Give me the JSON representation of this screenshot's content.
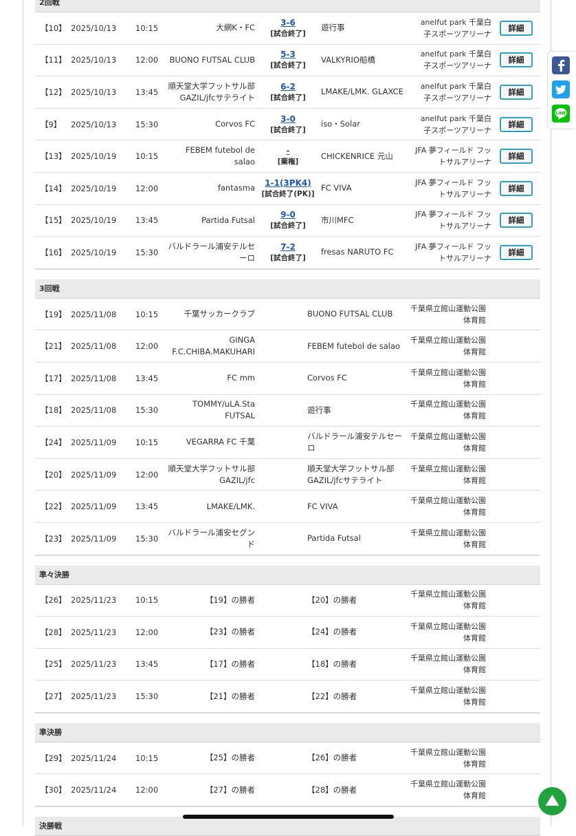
{
  "detail_label": "詳細",
  "sections": [
    {
      "title": "2回戦",
      "matches": [
        {
          "no": "【10】",
          "date": "2025/10/13",
          "time": "10:15",
          "home": "大網K・FC",
          "score": "3-6",
          "status": "[試合終了]",
          "away": "遊行事",
          "venue": "anelfut park 千葉白子スポーツアリーナ"
        },
        {
          "no": "【11】",
          "date": "2025/10/13",
          "time": "12:00",
          "home": "BUONO FUTSAL CLUB",
          "score": "5-3",
          "status": "[試合終了]",
          "away": "VALKYRIO船橋",
          "venue": "anelfut park 千葉白子スポーツアリーナ"
        },
        {
          "no": "【12】",
          "date": "2025/10/13",
          "time": "13:45",
          "home": "順天堂大学フットサル部GAZIL/jfcサテライト",
          "score": "6-2",
          "status": "[試合終了]",
          "away": "LMAKE/LMK. GLAXCE",
          "venue": "anelfut park 千葉白子スポーツアリーナ"
        },
        {
          "no": "【9】",
          "date": "2025/10/13",
          "time": "15:30",
          "home": "Corvos FC",
          "score": "3-0",
          "status": "[試合終了]",
          "away": "iso・Solar",
          "venue": "anelfut park 千葉白子スポーツアリーナ"
        },
        {
          "no": "【13】",
          "date": "2025/10/19",
          "time": "10:15",
          "home": "FEBEM futebol de salao",
          "score": "-",
          "status": "[棄権]",
          "away": "CHICKENRICE 元山",
          "venue": "JFA 夢フィールド フットサルアリーナ"
        },
        {
          "no": "【14】",
          "date": "2025/10/19",
          "time": "12:00",
          "home": "fantasma",
          "score": "1-1(3PK4)",
          "status": "[試合終了(PK)]",
          "away": "FC VIVA",
          "venue": "JFA 夢フィールド フットサルアリーナ"
        },
        {
          "no": "【15】",
          "date": "2025/10/19",
          "time": "13:45",
          "home": "Partida Futsal",
          "score": "9-0",
          "status": "[試合終了]",
          "away": "市川MFC",
          "venue": "JFA 夢フィールド フットサルアリーナ"
        },
        {
          "no": "【16】",
          "date": "2025/10/19",
          "time": "15:30",
          "home": "バルドラール浦安テルセーロ",
          "score": "7-2",
          "status": "[試合終了]",
          "away": "fresas NARUTO FC",
          "venue": "JFA 夢フィールド フットサルアリーナ"
        }
      ]
    },
    {
      "title": "3回戦",
      "matches": [
        {
          "no": "【19】",
          "date": "2025/11/08",
          "time": "10:15",
          "home": "千葉サッカークラブ",
          "away": "BUONO FUTSAL CLUB",
          "venue": "千葉県立館山運動公園体育館"
        },
        {
          "no": "【21】",
          "date": "2025/11/08",
          "time": "12:00",
          "home": "GINGA F.C.CHIBA.MAKUHARI",
          "away": "FEBEM futebol de salao",
          "venue": "千葉県立館山運動公園体育館"
        },
        {
          "no": "【17】",
          "date": "2025/11/08",
          "time": "13:45",
          "home": "FC mm",
          "away": "Corvos FC",
          "venue": "千葉県立館山運動公園体育館"
        },
        {
          "no": "【18】",
          "date": "2025/11/08",
          "time": "15:30",
          "home": "TOMMY/uLA.Sta FUTSAL",
          "away": "遊行事",
          "venue": "千葉県立館山運動公園体育館"
        },
        {
          "no": "【24】",
          "date": "2025/11/09",
          "time": "10:15",
          "home": "VEGARRA FC 千葉",
          "away": "バルドラール浦安テルセーロ",
          "venue": "千葉県立館山運動公園体育館"
        },
        {
          "no": "【20】",
          "date": "2025/11/09",
          "time": "12:00",
          "home": "順天堂大学フットサル部GAZIL/jfc",
          "away": "順天堂大学フットサル部GAZIL/jfcサテライト",
          "venue": "千葉県立館山運動公園体育館"
        },
        {
          "no": "【22】",
          "date": "2025/11/09",
          "time": "13:45",
          "home": "LMAKE/LMK.",
          "away": "FC VIVA",
          "venue": "千葉県立館山運動公園体育館"
        },
        {
          "no": "【23】",
          "date": "2025/11/09",
          "time": "15:30",
          "home": "バルドラール浦安セグンド",
          "away": "Partida Futsal",
          "venue": "千葉県立館山運動公園体育館"
        }
      ]
    },
    {
      "title": "準々決勝",
      "matches": [
        {
          "no": "【26】",
          "date": "2025/11/23",
          "time": "10:15",
          "home": "【19】の勝者",
          "away": "【20】の勝者",
          "venue": "千葉県立館山運動公園体育館"
        },
        {
          "no": "【28】",
          "date": "2025/11/23",
          "time": "12:00",
          "home": "【23】の勝者",
          "away": "【24】の勝者",
          "venue": "千葉県立館山運動公園体育館"
        },
        {
          "no": "【25】",
          "date": "2025/11/23",
          "time": "13:45",
          "home": "【17】の勝者",
          "away": "【18】の勝者",
          "venue": "千葉県立館山運動公園体育館"
        },
        {
          "no": "【27】",
          "date": "2025/11/23",
          "time": "15:30",
          "home": "【21】の勝者",
          "away": "【22】の勝者",
          "venue": "千葉県立館山運動公園体育館"
        }
      ]
    },
    {
      "title": "準決勝",
      "matches": [
        {
          "no": "【29】",
          "date": "2025/11/24",
          "time": "10:15",
          "home": "【25】の勝者",
          "away": "【26】の勝者",
          "venue": "千葉県立館山運動公園体育館"
        },
        {
          "no": "【30】",
          "date": "2025/11/24",
          "time": "12:00",
          "home": "【27】の勝者",
          "away": "【28】の勝者",
          "venue": "千葉県立館山運動公園体育館"
        }
      ]
    },
    {
      "title": "決勝戦",
      "matches": []
    }
  ],
  "social": {
    "facebook_icon": "facebook-icon",
    "facebook_color": "#3b5998",
    "twitter_icon": "twitter-icon",
    "twitter_color": "#1da1f2",
    "line_icon": "line-icon",
    "line_color": "#00c300"
  },
  "scroll_top": {
    "icon": "arrow-up-icon",
    "color": "#21a33c"
  }
}
